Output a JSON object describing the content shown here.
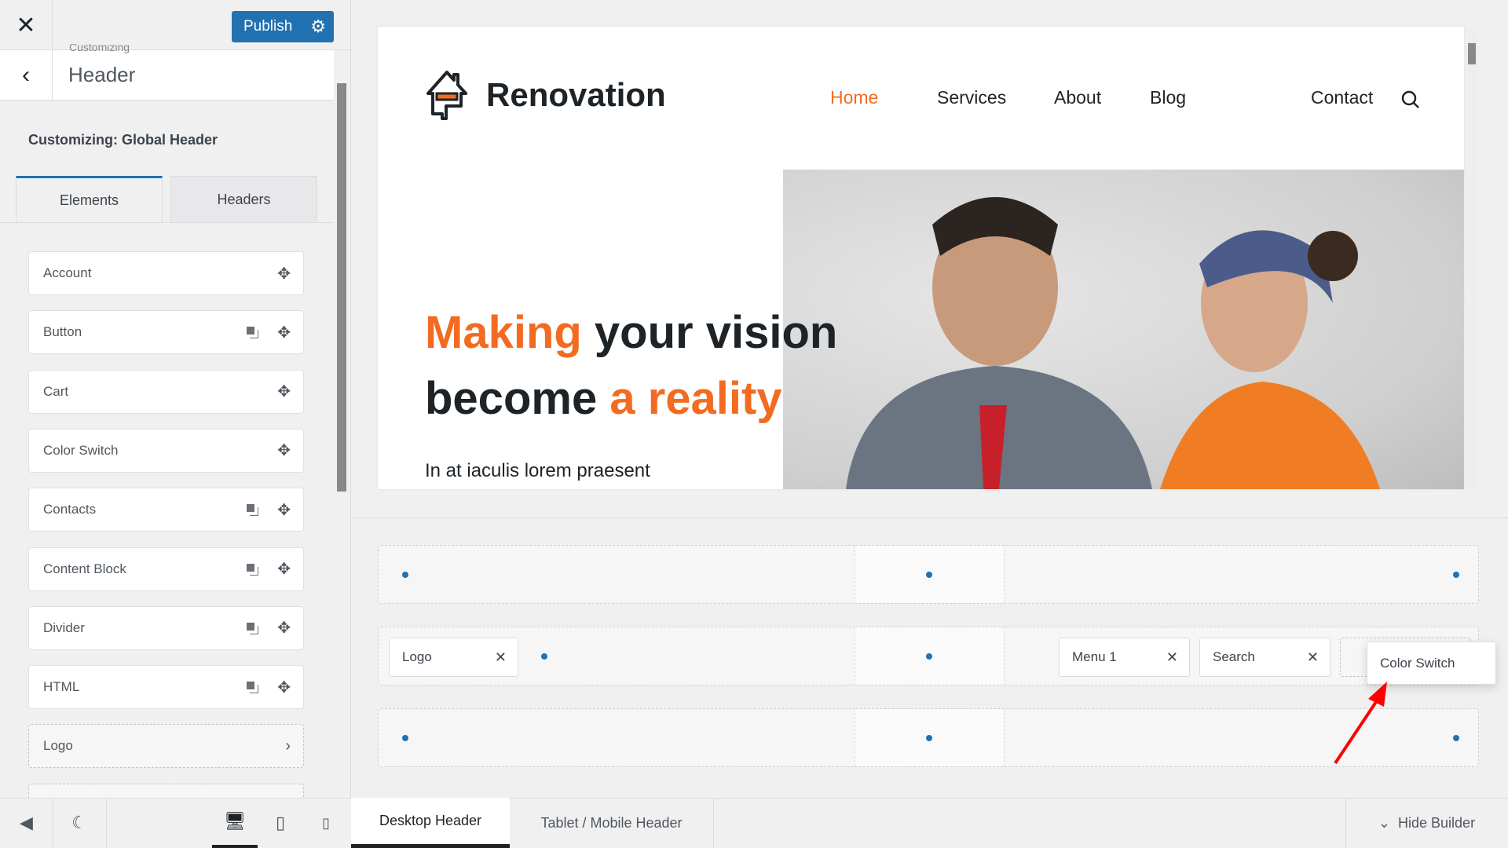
{
  "sidebar": {
    "publish_label": "Publish",
    "breadcrumb": "Customizing",
    "section_title": "Header",
    "customizing_label": "Customizing: Global Header",
    "tabs": [
      {
        "label": "Elements",
        "active": true
      },
      {
        "label": "Headers",
        "active": false
      }
    ],
    "items": [
      {
        "label": "Account",
        "duplicate": false
      },
      {
        "label": "Button",
        "duplicate": true
      },
      {
        "label": "Cart",
        "duplicate": false
      },
      {
        "label": "Color Switch",
        "duplicate": false
      },
      {
        "label": "Contacts",
        "duplicate": true
      },
      {
        "label": "Content Block",
        "duplicate": true
      },
      {
        "label": "Divider",
        "duplicate": true
      },
      {
        "label": "HTML",
        "duplicate": true
      },
      {
        "label": "Logo",
        "chevron": true
      }
    ]
  },
  "preview": {
    "brand": "Renovation",
    "nav": [
      {
        "label": "Home",
        "active": true
      },
      {
        "label": "Services"
      },
      {
        "label": "About"
      },
      {
        "label": "Blog"
      },
      {
        "label": "Contact"
      }
    ],
    "headline": {
      "l1a": "Making",
      "l1b": " your vision",
      "l2a": "become ",
      "l2b": "a reality"
    },
    "subtext": "In at iaculis lorem praesent",
    "accent": "#f26b21"
  },
  "builder": {
    "chips": {
      "logo": "Logo",
      "menu": "Menu 1",
      "search": "Search"
    },
    "dragging": "Color Switch"
  },
  "bottom": {
    "tabs": [
      {
        "label": "Desktop Header",
        "active": true
      },
      {
        "label": "Tablet / Mobile Header"
      }
    ],
    "hide_builder": "Hide Builder"
  }
}
